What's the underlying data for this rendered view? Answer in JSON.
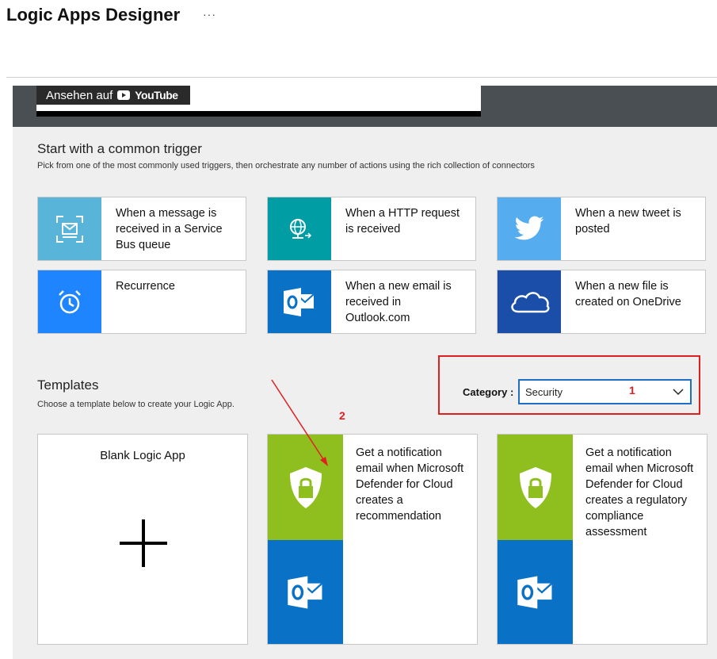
{
  "header": {
    "title": "Logic Apps Designer",
    "more": "···"
  },
  "video": {
    "watch_on": "Ansehen auf",
    "brand": "YouTube"
  },
  "triggers_section": {
    "title": "Start with a common trigger",
    "subtitle": "Pick from one of the most commonly used triggers, then orchestrate any number of actions using the rich collection of connectors"
  },
  "triggers": [
    {
      "label": "When a message is received in a Service Bus queue",
      "icon": "service-bus-icon",
      "color": "#59b4d9"
    },
    {
      "label": "When a HTTP request is received",
      "icon": "http-request-icon",
      "color": "#009da5"
    },
    {
      "label": "When a new tweet is posted",
      "icon": "twitter-icon",
      "color": "#55acee"
    },
    {
      "label": "Recurrence",
      "icon": "alarm-clock-icon",
      "color": "#1f85ff"
    },
    {
      "label": "When a new email is received in Outlook.com",
      "icon": "outlook-icon",
      "color": "#0a72c6"
    },
    {
      "label": "When a new file is created on OneDrive",
      "icon": "onedrive-icon",
      "color": "#1a4ea8"
    }
  ],
  "templates_section": {
    "title": "Templates",
    "subtitle": "Choose a template below to create your Logic App."
  },
  "category": {
    "label": "Category :",
    "value": "Security"
  },
  "annotations": {
    "one": "1",
    "two": "2",
    "color": "#e02020"
  },
  "templates": [
    {
      "label": "Blank Logic App",
      "icon": "plus-icon"
    },
    {
      "label": "Get a notification email when Microsoft Defender for Cloud creates a recommendation",
      "icon_top": "security-shield-icon",
      "icon_bottom": "outlook-icon",
      "top_color": "#8fbf1f",
      "bottom_color": "#0a72c6"
    },
    {
      "label": "Get a notification email when Microsoft Defender for Cloud creates a regulatory compliance assessment",
      "icon_top": "security-shield-icon",
      "icon_bottom": "outlook-icon",
      "top_color": "#8fbf1f",
      "bottom_color": "#0a72c6"
    }
  ]
}
